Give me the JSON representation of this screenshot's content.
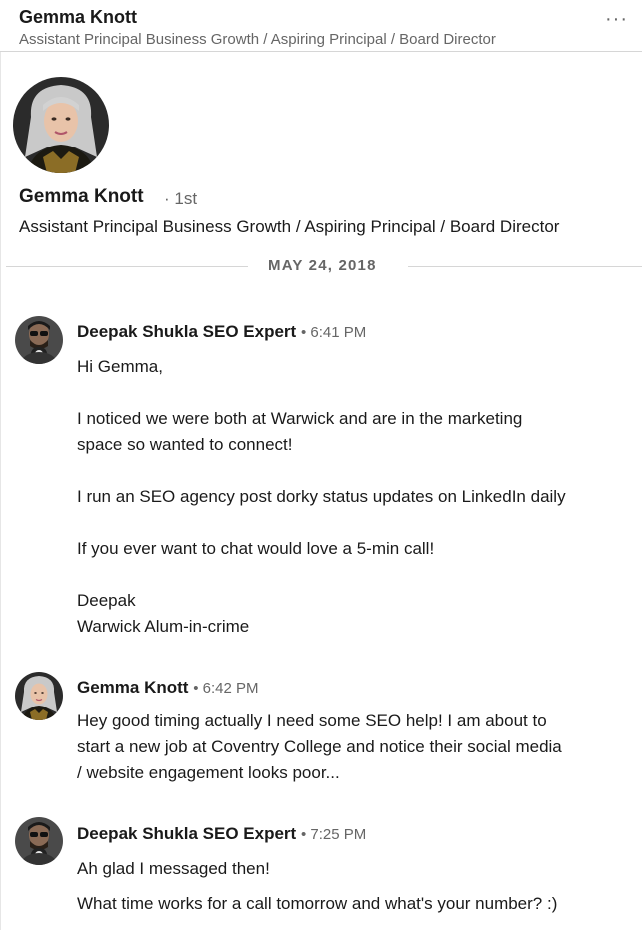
{
  "header": {
    "name": "Gemma Knott",
    "headline": "Assistant Principal Business Growth / Aspiring Principal / Board Director",
    "more_icon": "ellipsis-icon"
  },
  "profile": {
    "name": "Gemma Knott",
    "degree": "· 1st",
    "headline": "Assistant Principal Business Growth / Aspiring Principal / Board Director"
  },
  "date_divider": "MAY 24, 2018",
  "messages": [
    {
      "sender": "Deepak Shukla SEO Expert",
      "time": "• 6:41 PM",
      "lines": [
        "Hi Gemma,",
        "I noticed we were both at Warwick and are in the marketing",
        "space so wanted to connect!",
        "I run an SEO agency post dorky status updates on LinkedIn daily",
        "If you ever want to chat would love a 5-min call!",
        "Deepak",
        "Warwick Alum-in-crime"
      ]
    },
    {
      "sender": "Gemma Knott",
      "time": "• 6:42 PM",
      "lines": [
        "Hey good timing actually I need some SEO help! I am about to",
        "start a new job at Coventry College and notice their social media",
        "/ website engagement looks poor..."
      ]
    },
    {
      "sender": "Deepak Shukla SEO Expert",
      "time": "• 7:25 PM",
      "lines": [
        "Ah glad I messaged then!",
        "What time works for a call tomorrow and what's your number? :)"
      ]
    }
  ]
}
